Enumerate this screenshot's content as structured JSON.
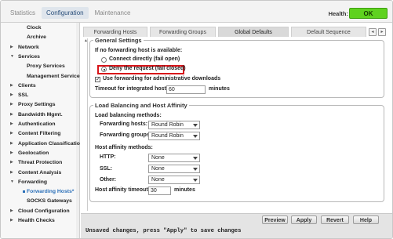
{
  "top_nav": {
    "tabs": [
      {
        "label": "Statistics",
        "active": false
      },
      {
        "label": "Configuration",
        "active": true
      },
      {
        "label": "Maintenance",
        "active": false
      }
    ],
    "health_label": "Health:",
    "health_status": "OK",
    "health_color": "#5fd21f"
  },
  "sidebar": {
    "items": [
      {
        "label": "Clock",
        "arrow": "",
        "bold": true,
        "active": false
      },
      {
        "label": "Archive",
        "arrow": "",
        "bold": true,
        "active": false
      },
      {
        "label": "Network",
        "arrow": "▶",
        "bold": true,
        "active": false
      },
      {
        "label": "Services",
        "arrow": "▼",
        "bold": true,
        "active": false
      },
      {
        "label": "Proxy Services",
        "arrow": "",
        "bold": true,
        "active": false
      },
      {
        "label": "Management Services",
        "arrow": "",
        "bold": true,
        "active": false
      },
      {
        "label": "Clients",
        "arrow": "▶",
        "bold": true,
        "active": false
      },
      {
        "label": "SSL",
        "arrow": "▶",
        "bold": true,
        "active": false
      },
      {
        "label": "Proxy Settings",
        "arrow": "▶",
        "bold": true,
        "active": false
      },
      {
        "label": "Bandwidth Mgmt.",
        "arrow": "▶",
        "bold": true,
        "active": false
      },
      {
        "label": "Authentication",
        "arrow": "▶",
        "bold": true,
        "active": false
      },
      {
        "label": "Content Filtering",
        "arrow": "▶",
        "bold": true,
        "active": false
      },
      {
        "label": "Application Classification",
        "arrow": "▶",
        "bold": true,
        "active": false
      },
      {
        "label": "Geolocation",
        "arrow": "▶",
        "bold": true,
        "active": false
      },
      {
        "label": "Threat Protection",
        "arrow": "▶",
        "bold": true,
        "active": false
      },
      {
        "label": "Content Analysis",
        "arrow": "▶",
        "bold": true,
        "active": false
      },
      {
        "label": "Forwarding",
        "arrow": "▼",
        "bold": true,
        "active": false
      },
      {
        "label": "Forwarding Hosts*",
        "arrow": "",
        "bold": true,
        "active": true
      },
      {
        "label": "SOCKS Gateways",
        "arrow": "",
        "bold": true,
        "active": false
      },
      {
        "label": "Cloud Configuration",
        "arrow": "▶",
        "bold": true,
        "active": false
      },
      {
        "label": "Health Checks",
        "arrow": "▶",
        "bold": true,
        "active": false
      }
    ]
  },
  "panel_tabs": [
    {
      "label": "Forwarding Hosts",
      "active": false
    },
    {
      "label": "Forwarding Groups",
      "active": false
    },
    {
      "label": "Global Defaults",
      "active": true
    },
    {
      "label": "Default Sequence",
      "active": false
    }
  ],
  "general": {
    "legend": "General Settings",
    "no_host_label": "If no forwarding host is available:",
    "option_connect": "Connect directly (fail open)",
    "option_deny": "Deny the request (fail closed)",
    "use_forwarding_label": "Use forwarding for administrative downloads",
    "timeout_label": "Timeout for integrated hosts:",
    "timeout_value": "60",
    "timeout_unit": "minutes"
  },
  "lb": {
    "legend": "Load Balancing and Host Affinity",
    "methods_label": "Load balancing methods:",
    "hosts_label": "Forwarding hosts:",
    "hosts_value": "Round Robin",
    "groups_label": "Forwarding groups:",
    "groups_value": "Round Robin",
    "affinity_label": "Host affinity methods:",
    "http_label": "HTTP:",
    "http_value": "None",
    "ssl_label": "SSL:",
    "ssl_value": "None",
    "other_label": "Other:",
    "other_value": "None",
    "affinity_timeout_label": "Host affinity timeout:",
    "affinity_timeout_value": "30",
    "affinity_timeout_unit": "minutes"
  },
  "footer": {
    "preview": "Preview",
    "apply": "Apply",
    "revert": "Revert",
    "help": "Help",
    "unsaved": "Unsaved changes, press \"Apply\" to save changes"
  }
}
